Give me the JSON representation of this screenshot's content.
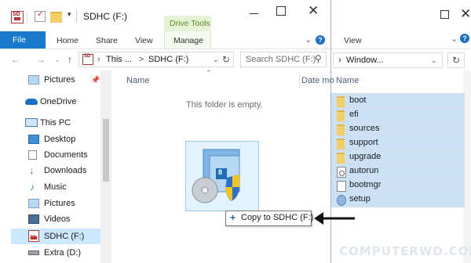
{
  "front_window": {
    "title": "SDHC (F:)",
    "context_tab": "Drive Tools",
    "ribbon_tabs": [
      "File",
      "Home",
      "Share",
      "View",
      "Manage"
    ],
    "address_prefix": "This ...",
    "address_sep": ">",
    "address_current": "SDHC (F:)",
    "search_placeholder": "Search SDHC (F:)",
    "column_name": "Name",
    "column_date": "Date mo",
    "empty_message": "This folder is empty.",
    "drive_badge": "SD",
    "tile_number": "8"
  },
  "sidebar": {
    "items": [
      {
        "label": "Pictures",
        "icon": "pictures-folder-icon"
      },
      {
        "label": "OneDrive",
        "icon": "onedrive-cloud-icon"
      },
      {
        "label": "This PC",
        "icon": "computer-icon"
      },
      {
        "label": "Desktop",
        "icon": "desktop-folder-icon"
      },
      {
        "label": "Documents",
        "icon": "documents-folder-icon"
      },
      {
        "label": "Downloads",
        "icon": "downloads-folder-icon"
      },
      {
        "label": "Music",
        "icon": "music-folder-icon"
      },
      {
        "label": "Pictures",
        "icon": "pictures-folder-icon"
      },
      {
        "label": "Videos",
        "icon": "videos-folder-icon"
      },
      {
        "label": "SDHC (F:)",
        "icon": "sd-card-icon"
      },
      {
        "label": "Extra (D:)",
        "icon": "drive-icon"
      }
    ]
  },
  "back_window": {
    "view_tab": "View",
    "address_text": "Window...",
    "column_name": "Name",
    "files": [
      {
        "label": "boot",
        "icon": "folder-icon"
      },
      {
        "label": "efi",
        "icon": "folder-icon"
      },
      {
        "label": "sources",
        "icon": "folder-icon"
      },
      {
        "label": "support",
        "icon": "folder-icon"
      },
      {
        "label": "upgrade",
        "icon": "folder-icon"
      },
      {
        "label": "autorun",
        "icon": "settings-file-icon"
      },
      {
        "label": "bootmgr",
        "icon": "file-icon"
      },
      {
        "label": "setup",
        "icon": "setup-icon"
      }
    ]
  },
  "drag": {
    "tooltip_plus": "+",
    "tooltip_text": "Copy to SDHC (F:)"
  },
  "watermark": "COMPUTERWD.COM",
  "colors": {
    "file_tab": "#1979ca",
    "context_tab_bg": "#e6f3d6",
    "context_tab_text": "#5c8a2a",
    "selection": "#cce8ff",
    "folder": "#f5cf66",
    "onedrive": "#1b6fc9"
  }
}
